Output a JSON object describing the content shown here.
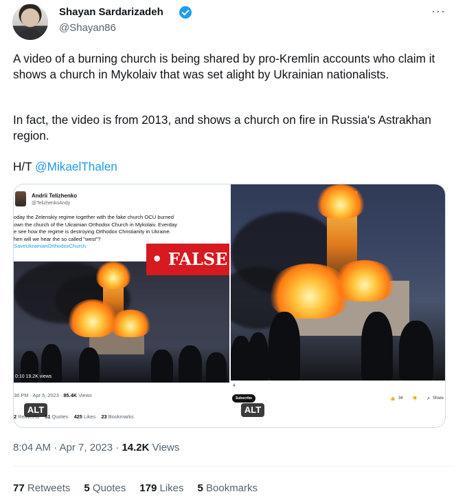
{
  "author": {
    "name": "Shayan Sardarizadeh",
    "handle": "@Shayan86"
  },
  "more_icon": "ellipsis-icon",
  "tweet": {
    "paragraph1": "A video of a burning church is being shared by pro-Kremlin accounts who claim it shows a church in Mykolaiv that was set alight by Ukrainian nationalists.",
    "paragraph2": "In fact, the video is from 2013, and shows a church on fire in Russia's Astrakhan region.",
    "ht_prefix": "H/T ",
    "mention": "@MikaelThalen"
  },
  "media": {
    "left": {
      "embedded_name": "Andrii Telizhenko",
      "embedded_handle": "@TelizhenkoAndy",
      "embedded_text": "oday the Zelenskiy regime together with the fake church OCU burned\nown the church of the Ukrainian Orthodox Church in Mykolaiv. Everday\ne see how the regime is destroying Orthodox Christianity in Ukraine.\nhen will we hear the so called \"west\"?",
      "embedded_hashtag": "SaveUkrainianOrthodoxChurch",
      "false_label": "• FALSE",
      "video_views": "0:10  19.2K views",
      "meta_time": "36 PM · Apr 5, 2023 · ",
      "meta_views": "85.4K",
      "meta_views_label": " Views",
      "stats": [
        {
          "count": "2",
          "label": " Retweets"
        },
        {
          "count": "51",
          "label": " Quotes"
        },
        {
          "count": "425",
          "label": " Likes"
        },
        {
          "count": "23",
          "label": " Bookmarks"
        }
      ],
      "alt": "ALT"
    },
    "right": {
      "counter": "4",
      "subscribe": "Subscribe",
      "likes": "34",
      "share": "Share",
      "alt": "ALT"
    }
  },
  "timestamp": {
    "time": "8:04 AM · Apr 7, 2023 · ",
    "views": "14.2K",
    "views_label": " Views"
  },
  "stats": {
    "retweets_count": "77",
    "retweets_label": "Retweets",
    "quotes_count": "5",
    "quotes_label": "Quotes",
    "likes_count": "179",
    "likes_label": "Likes",
    "bookmarks_count": "5",
    "bookmarks_label": "Bookmarks"
  },
  "colors": {
    "accent": "#1d9bf0",
    "false_badge": "#d71920",
    "secondary_text": "#536471"
  }
}
